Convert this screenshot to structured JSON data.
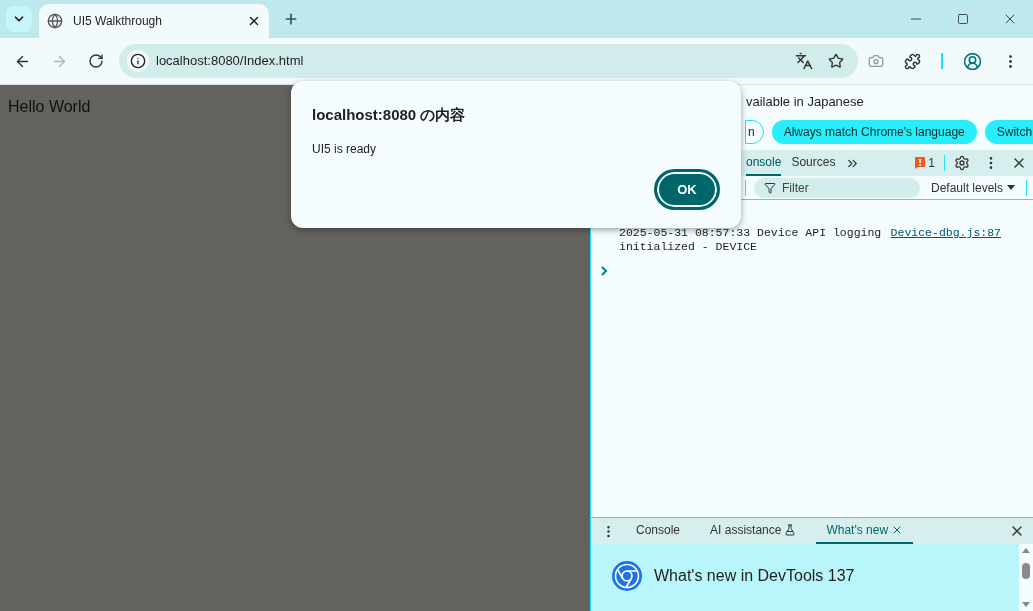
{
  "browser": {
    "tab": {
      "title": "UI5 Walkthrough",
      "selected": true
    },
    "url": "localhost:8080/Index.html",
    "forward_disabled": true
  },
  "page": {
    "heading": "Hello World"
  },
  "dialog": {
    "title": "localhost:8080 の内容",
    "message": "UI5 is ready",
    "button": "OK"
  },
  "devtools": {
    "infobar": {
      "text": "vailable in Japanese",
      "buttons": [
        {
          "label": "n",
          "kind": "outline"
        },
        {
          "label": "Always match Chrome's language",
          "kind": "filled"
        },
        {
          "label": "Switch",
          "kind": "filled"
        }
      ]
    },
    "tabs": [
      {
        "label": "onsole",
        "selected": true
      },
      {
        "label": "Sources",
        "selected": false
      }
    ],
    "issues_count": "1",
    "filter": {
      "placeholder": "Filter"
    },
    "levels": "Default levels",
    "messages": [
      {
        "text": "2025-05-31 08:57:33 Device API logging initialized - DEVICE",
        "source": "Device-dbg.js:87"
      }
    ],
    "drawer": {
      "tabs": [
        {
          "label": "Console",
          "selected": false,
          "kind": "plain"
        },
        {
          "label": "AI assistance",
          "selected": false,
          "kind": "experiment"
        },
        {
          "label": "What's new",
          "selected": true,
          "kind": "closable"
        }
      ],
      "heading": "What's new in DevTools 137"
    }
  }
}
